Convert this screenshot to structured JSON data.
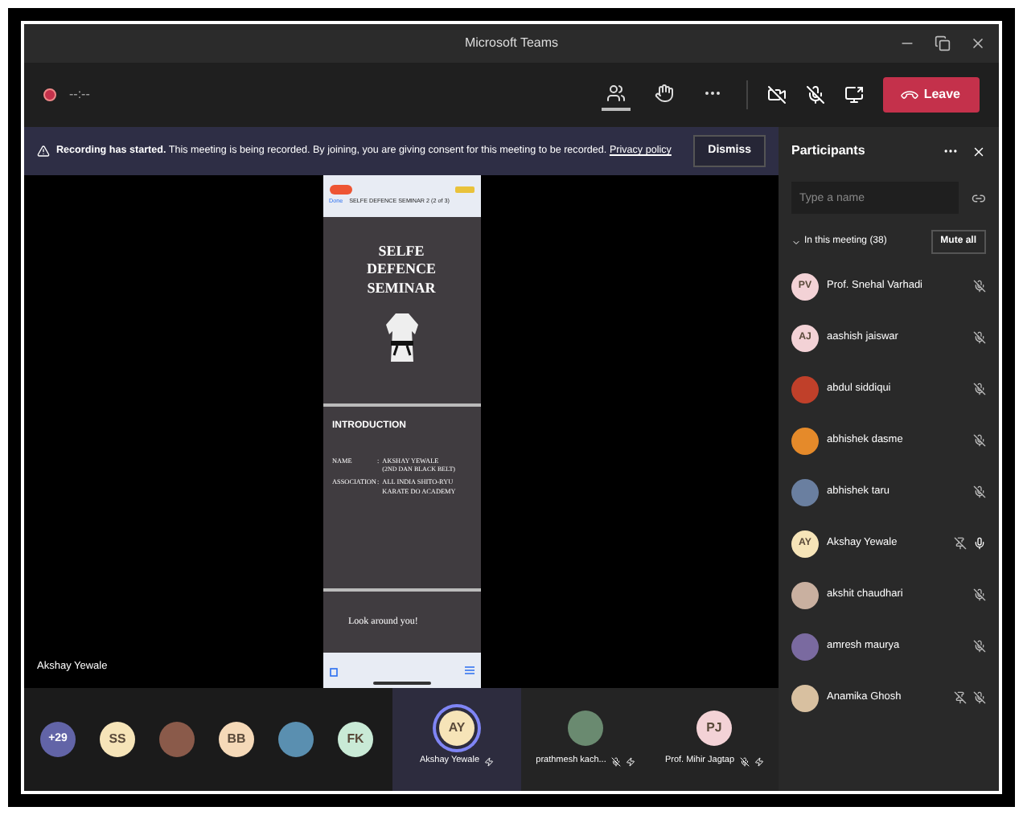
{
  "window": {
    "title": "Microsoft Teams"
  },
  "toolbar": {
    "timer": "--:--",
    "leave_label": "Leave",
    "items": [
      {
        "kind": "people",
        "selected": true
      },
      {
        "kind": "hand",
        "selected": false
      },
      {
        "kind": "more",
        "selected": false
      }
    ]
  },
  "banner": {
    "text": "**Recording has started.** This meeting is being recorded. By joining, you are giving consent for this meeting to be recorded.",
    "link": "Privacy policy",
    "button": "Dismiss"
  },
  "stage": {
    "presenter": "Akshay Yewale",
    "phone": {
      "back": "Done",
      "doc_title": "SELFE DEFENCE  SEMINAR 2 (2 of 3)",
      "slide_title": "SELFE DEFENCE SEMINAR",
      "section": "INTRODUCTION",
      "fields": [
        {
          "label": "NAME",
          "sep": ":",
          "value": "AKSHAY YEWALE",
          "note": "(2ND DAN BLACK BELT)"
        },
        {
          "label": "ASSOCIATION",
          "sep": ":",
          "value": "ALL INDIA SHITO-RYU KARATE DO ACADEMY"
        }
      ],
      "footer_text": "Look around you!"
    }
  },
  "strip": {
    "avatars": [
      {
        "kind": "count",
        "text": "+29",
        "color": "#6264a7"
      },
      {
        "kind": "initials",
        "text": "SS",
        "color": "#f6e4b8"
      },
      {
        "kind": "photo",
        "color": "#8a5a4a"
      },
      {
        "kind": "initials",
        "text": "BB",
        "color": "#f5d9b8"
      },
      {
        "kind": "photo",
        "color": "#5a8fb0"
      },
      {
        "kind": "initials",
        "text": "FK",
        "color": "#c9ead6"
      }
    ],
    "tiles": [
      {
        "name": "Akshay Yewale",
        "avatar": "AY",
        "color": "#f6e4b8",
        "photo": false,
        "selected": true,
        "muted": false
      },
      {
        "name": "prathmesh kach...",
        "color": "#6a8a70",
        "photo": true,
        "selected": false,
        "muted": true
      },
      {
        "name": "Prof. Mihir Jagtap",
        "avatar": "PJ",
        "color": "#f3d2d6",
        "photo": false,
        "selected": false,
        "muted": true
      }
    ]
  },
  "participants": {
    "title": "Participants",
    "search": {
      "placeholder": "Type a name"
    },
    "section": "In this meeting (38)",
    "expanded": true,
    "mute_all": "Mute all",
    "people": [
      {
        "name": "Prof. Snehal Varhadi",
        "avatar": "PV",
        "color": "#f3d2d6",
        "photo": false,
        "muted": true,
        "pinned": false
      },
      {
        "name": "aashish jaiswar",
        "avatar": "AJ",
        "color": "#f3d2d6",
        "photo": false,
        "muted": true,
        "pinned": false
      },
      {
        "name": "abdul siddiqui",
        "color": "#c0402a",
        "photo": true,
        "muted": true,
        "pinned": false
      },
      {
        "name": "abhishek dasme",
        "color": "#e58a2a",
        "photo": true,
        "muted": true,
        "pinned": false
      },
      {
        "name": "abhishek taru",
        "color": "#6a7fa0",
        "photo": true,
        "muted": true,
        "pinned": false
      },
      {
        "name": "Akshay Yewale",
        "avatar": "AY",
        "color": "#f6e4b8",
        "photo": false,
        "muted": false,
        "pinned": true
      },
      {
        "name": "akshit chaudhari",
        "color": "#c9b0a0",
        "photo": true,
        "muted": true,
        "pinned": false
      },
      {
        "name": "amresh maurya",
        "color": "#7a6aa0",
        "photo": true,
        "muted": true,
        "pinned": false
      },
      {
        "name": "Anamika Ghosh",
        "color": "#d8c0a0",
        "photo": true,
        "muted": true,
        "pinned": true
      }
    ]
  }
}
